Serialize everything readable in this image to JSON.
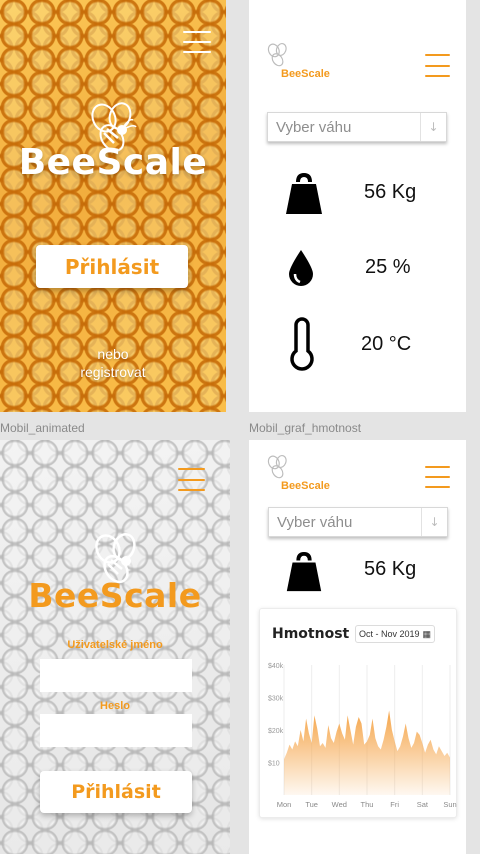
{
  "brand": {
    "name": "BeeScale"
  },
  "screen_login_animated": {
    "label": "Mobil_animated",
    "login_button": "Přihlásit",
    "register_text_line1": "nebo",
    "register_text_line2": "registrovat"
  },
  "screen_dashboard": {
    "label": "Mobil_graf_hmotnost",
    "select_placeholder": "Vyber váhu",
    "weight": "56 Kg",
    "humidity": "25 %",
    "temperature": "20 °C"
  },
  "screen_login_form": {
    "username_label": "Uživatelské jméno",
    "password_label": "Heslo",
    "username_value": "",
    "password_value": "",
    "login_button": "Přihlásit"
  },
  "screen_graph": {
    "select_placeholder": "Vyber váhu",
    "weight": "56 Kg",
    "chart_title": "Hmotnost",
    "date_range": "Oct - Nov 2019"
  },
  "colors": {
    "accent": "#f39a1e",
    "honey": "#f2a21c",
    "text": "#111111"
  },
  "icons": [
    "hamburger-menu-icon",
    "bee-icon",
    "weight-icon",
    "water-drop-icon",
    "thermometer-icon",
    "chevron-down-icon",
    "calendar-icon"
  ],
  "chart_data": {
    "type": "area",
    "title": "Hmotnost",
    "subtitle": "Oct - Nov 2019",
    "y_ticks": [
      "$40k",
      "$30k",
      "$20k",
      "$10"
    ],
    "x_ticks": [
      "Mon",
      "Tue",
      "Wed",
      "Thu",
      "Fri",
      "Sat",
      "Sun"
    ],
    "ylim": [
      0,
      40000
    ],
    "x": [
      0,
      1,
      2,
      3,
      4,
      5,
      6,
      7,
      8,
      9,
      10,
      11,
      12,
      13,
      14,
      15,
      16,
      17,
      18,
      19,
      20,
      21,
      22,
      23,
      24,
      25,
      26,
      27,
      28,
      29,
      30,
      31,
      32,
      33,
      34,
      35,
      36,
      37,
      38,
      39,
      40,
      41,
      42,
      43,
      44,
      45,
      46,
      47,
      48,
      49,
      50,
      51,
      52,
      53,
      54,
      55,
      56,
      57,
      58,
      59,
      60
    ],
    "values": [
      11000,
      13000,
      15500,
      14000,
      16500,
      15000,
      20000,
      16500,
      23500,
      19000,
      16000,
      24500,
      20500,
      15000,
      16000,
      14500,
      21500,
      17500,
      16000,
      19500,
      22000,
      19000,
      17000,
      24500,
      20000,
      15500,
      21000,
      24000,
      22000,
      15500,
      16500,
      18500,
      23500,
      17500,
      15000,
      14000,
      17000,
      21000,
      26000,
      20000,
      16500,
      13500,
      15000,
      18000,
      22000,
      17500,
      14500,
      16000,
      19500,
      18500,
      16000,
      13000,
      15500,
      17000,
      14000,
      12500,
      15000,
      13500,
      12000,
      13000,
      11500
    ],
    "grid": false,
    "color": "#f5a54a"
  }
}
